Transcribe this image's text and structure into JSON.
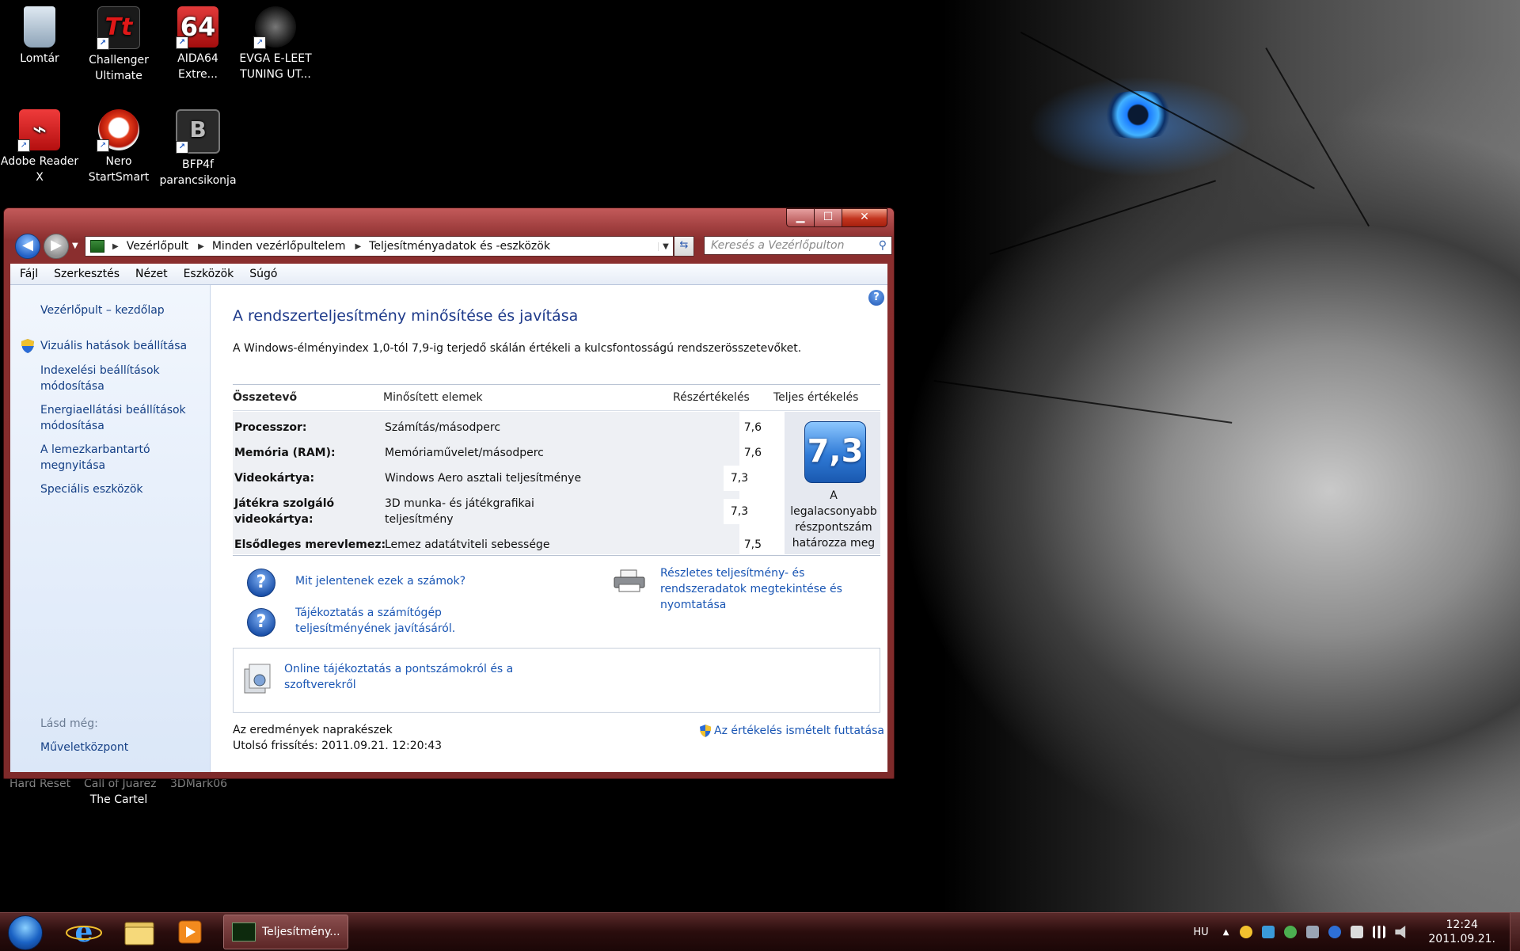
{
  "desktop": {
    "icons": [
      {
        "label": "Lomtár",
        "icon": "recycle-bin-icon"
      },
      {
        "label": "Challenger Ultimate",
        "icon": "challenger-app-icon",
        "badge": "Tt"
      },
      {
        "label": "AIDA64 Extre...",
        "icon": "aida64-icon",
        "badge": "64"
      },
      {
        "label": "EVGA E-LEET TUNING UT...",
        "icon": "evga-icon"
      },
      {
        "label": "Adobe Reader X",
        "icon": "adobe-reader-icon"
      },
      {
        "label": "Nero StartSmart",
        "icon": "nero-icon"
      },
      {
        "label": "BFP4f parancsikonja",
        "icon": "bfp4f-icon",
        "badge": "B"
      }
    ],
    "behind_window": [
      "Hard Reset",
      "Call of Juarez",
      "3DMark06",
      "The Cartel"
    ]
  },
  "window": {
    "controls": {
      "minimize": "▁",
      "maximize": "☐",
      "close": "✕"
    },
    "breadcrumb": [
      "Vezérlőpult",
      "Minden vezérlőpultelem",
      "Teljesítményadatok és -eszközök"
    ],
    "search_placeholder": "Keresés a Vezérlőpulton",
    "menu": [
      "Fájl",
      "Szerkesztés",
      "Nézet",
      "Eszközök",
      "Súgó"
    ],
    "sidebar": {
      "home": "Vezérlőpult – kezdőlap",
      "links": [
        "Vizuális hatások beállítása",
        "Indexelési beállítások módosítása",
        "Energiaellátási beállítások módosítása",
        "A lemezkarbantartó megnyitása",
        "Speciális eszközök"
      ],
      "see_also_label": "Lásd még:",
      "see_also": [
        "Műveletközpont"
      ]
    },
    "main": {
      "title": "A rendszerteljesítmény minősítése és javítása",
      "subtitle": "A Windows-élményindex 1,0-tól 7,9-ig terjedő skálán értékeli a kulcsfontosságú rendszerösszetevőket.",
      "headers": [
        "Összetevő",
        "Minősített elemek",
        "Részértékelés",
        "Teljes értékelés"
      ],
      "rows": [
        {
          "component": "Processzor:",
          "item": "Számítás/másodperc",
          "score": "7,6"
        },
        {
          "component": "Memória (RAM):",
          "item": "Memóriaművelet/másodperc",
          "score": "7,6"
        },
        {
          "component": "Videokártya:",
          "item": "Windows Aero asztali teljesítménye",
          "score": "7,3"
        },
        {
          "component": "Játékra szolgáló videokártya:",
          "item": "3D munka- és játékgrafikai teljesítmény",
          "score": "7,3"
        },
        {
          "component": "Elsődleges merevlemez:",
          "item": "Lemez adatátviteli sebessége",
          "score": "7,5"
        }
      ],
      "base_score": "7,3",
      "base_score_note": "A legalacsonyabb részpontszám határozza meg",
      "links": {
        "what_numbers": "Mit jelentenek ezek a számok?",
        "improve": "Tájékoztatás a számítógép teljesítményének javításáról.",
        "detailed": "Részletes teljesítmény- és rendszeradatok megtekintése és nyomtatása",
        "online": "Online tájékoztatás a pontszámokról és a szoftverekről"
      },
      "status": {
        "up_to_date": "Az eredmények naprakészek",
        "last_update": "Utolsó frissítés: 2011.09.21. 12:20:43",
        "rerun": "Az értékelés ismételt futtatása"
      }
    }
  },
  "taskbar": {
    "active_task": "Teljesítmény...",
    "language": "HU",
    "time": "12:24",
    "date": "2011.09.21."
  },
  "colors": {
    "window_frame": "#8a2e2e",
    "link": "#1a56b4",
    "score_tile": "#2f7ad6"
  }
}
